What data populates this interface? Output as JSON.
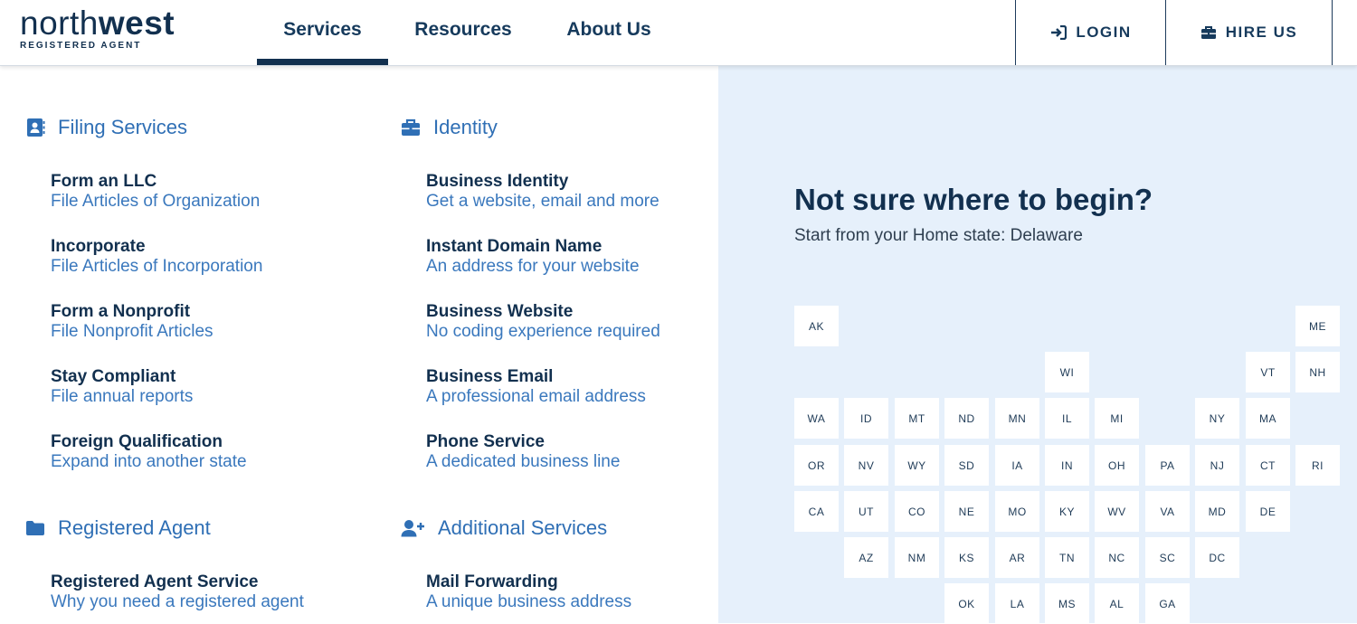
{
  "logo": {
    "word_a": "north",
    "word_b": "west",
    "tagline": "REGISTERED AGENT"
  },
  "nav": {
    "services": "Services",
    "resources": "Resources",
    "about": "About Us"
  },
  "header_buttons": {
    "login": "LOGIN",
    "hire": "HIRE US"
  },
  "filing": {
    "title": "Filing Services",
    "items": [
      {
        "title": "Form an LLC",
        "sub": "File Articles of Organization"
      },
      {
        "title": "Incorporate",
        "sub": "File Articles of Incorporation"
      },
      {
        "title": "Form a Nonprofit",
        "sub": "File Nonprofit Articles"
      },
      {
        "title": "Stay Compliant",
        "sub": "File annual reports"
      },
      {
        "title": "Foreign Qualification",
        "sub": "Expand into another state"
      }
    ]
  },
  "identity": {
    "title": "Identity",
    "items": [
      {
        "title": "Business Identity",
        "sub": "Get a website, email and more"
      },
      {
        "title": "Instant Domain Name",
        "sub": "An address for your website"
      },
      {
        "title": "Business Website",
        "sub": "No coding experience required"
      },
      {
        "title": "Business Email",
        "sub": "A professional email address"
      },
      {
        "title": "Phone Service",
        "sub": "A dedicated business line"
      }
    ]
  },
  "registered_agent": {
    "title": "Registered Agent",
    "items": [
      {
        "title": "Registered Agent Service",
        "sub": "Why you need a registered agent"
      }
    ]
  },
  "additional": {
    "title": "Additional Services",
    "items": [
      {
        "title": "Mail Forwarding",
        "sub": "A unique business address"
      }
    ]
  },
  "panel": {
    "title": "Not sure where to begin?",
    "subtitle": "Start from your Home state: Delaware"
  },
  "states": [
    {
      "code": "AK",
      "col": 0,
      "row": 0
    },
    {
      "code": "ME",
      "col": 10,
      "row": 0
    },
    {
      "code": "WI",
      "col": 5,
      "row": 1
    },
    {
      "code": "VT",
      "col": 9,
      "row": 1
    },
    {
      "code": "NH",
      "col": 10,
      "row": 1
    },
    {
      "code": "WA",
      "col": 0,
      "row": 2
    },
    {
      "code": "ID",
      "col": 1,
      "row": 2
    },
    {
      "code": "MT",
      "col": 2,
      "row": 2
    },
    {
      "code": "ND",
      "col": 3,
      "row": 2
    },
    {
      "code": "MN",
      "col": 4,
      "row": 2
    },
    {
      "code": "IL",
      "col": 5,
      "row": 2
    },
    {
      "code": "MI",
      "col": 6,
      "row": 2
    },
    {
      "code": "NY",
      "col": 8,
      "row": 2
    },
    {
      "code": "MA",
      "col": 9,
      "row": 2
    },
    {
      "code": "OR",
      "col": 0,
      "row": 3
    },
    {
      "code": "NV",
      "col": 1,
      "row": 3
    },
    {
      "code": "WY",
      "col": 2,
      "row": 3
    },
    {
      "code": "SD",
      "col": 3,
      "row": 3
    },
    {
      "code": "IA",
      "col": 4,
      "row": 3
    },
    {
      "code": "IN",
      "col": 5,
      "row": 3
    },
    {
      "code": "OH",
      "col": 6,
      "row": 3
    },
    {
      "code": "PA",
      "col": 7,
      "row": 3
    },
    {
      "code": "NJ",
      "col": 8,
      "row": 3
    },
    {
      "code": "CT",
      "col": 9,
      "row": 3
    },
    {
      "code": "RI",
      "col": 10,
      "row": 3
    },
    {
      "code": "CA",
      "col": 0,
      "row": 4
    },
    {
      "code": "UT",
      "col": 1,
      "row": 4
    },
    {
      "code": "CO",
      "col": 2,
      "row": 4
    },
    {
      "code": "NE",
      "col": 3,
      "row": 4
    },
    {
      "code": "MO",
      "col": 4,
      "row": 4
    },
    {
      "code": "KY",
      "col": 5,
      "row": 4
    },
    {
      "code": "WV",
      "col": 6,
      "row": 4
    },
    {
      "code": "VA",
      "col": 7,
      "row": 4
    },
    {
      "code": "MD",
      "col": 8,
      "row": 4
    },
    {
      "code": "DE",
      "col": 9,
      "row": 4
    },
    {
      "code": "AZ",
      "col": 1,
      "row": 5
    },
    {
      "code": "NM",
      "col": 2,
      "row": 5
    },
    {
      "code": "KS",
      "col": 3,
      "row": 5
    },
    {
      "code": "AR",
      "col": 4,
      "row": 5
    },
    {
      "code": "TN",
      "col": 5,
      "row": 5
    },
    {
      "code": "NC",
      "col": 6,
      "row": 5
    },
    {
      "code": "SC",
      "col": 7,
      "row": 5
    },
    {
      "code": "DC",
      "col": 8,
      "row": 5
    },
    {
      "code": "OK",
      "col": 3,
      "row": 6
    },
    {
      "code": "LA",
      "col": 4,
      "row": 6
    },
    {
      "code": "MS",
      "col": 5,
      "row": 6
    },
    {
      "code": "AL",
      "col": 6,
      "row": 6
    },
    {
      "code": "GA",
      "col": 7,
      "row": 6
    }
  ]
}
